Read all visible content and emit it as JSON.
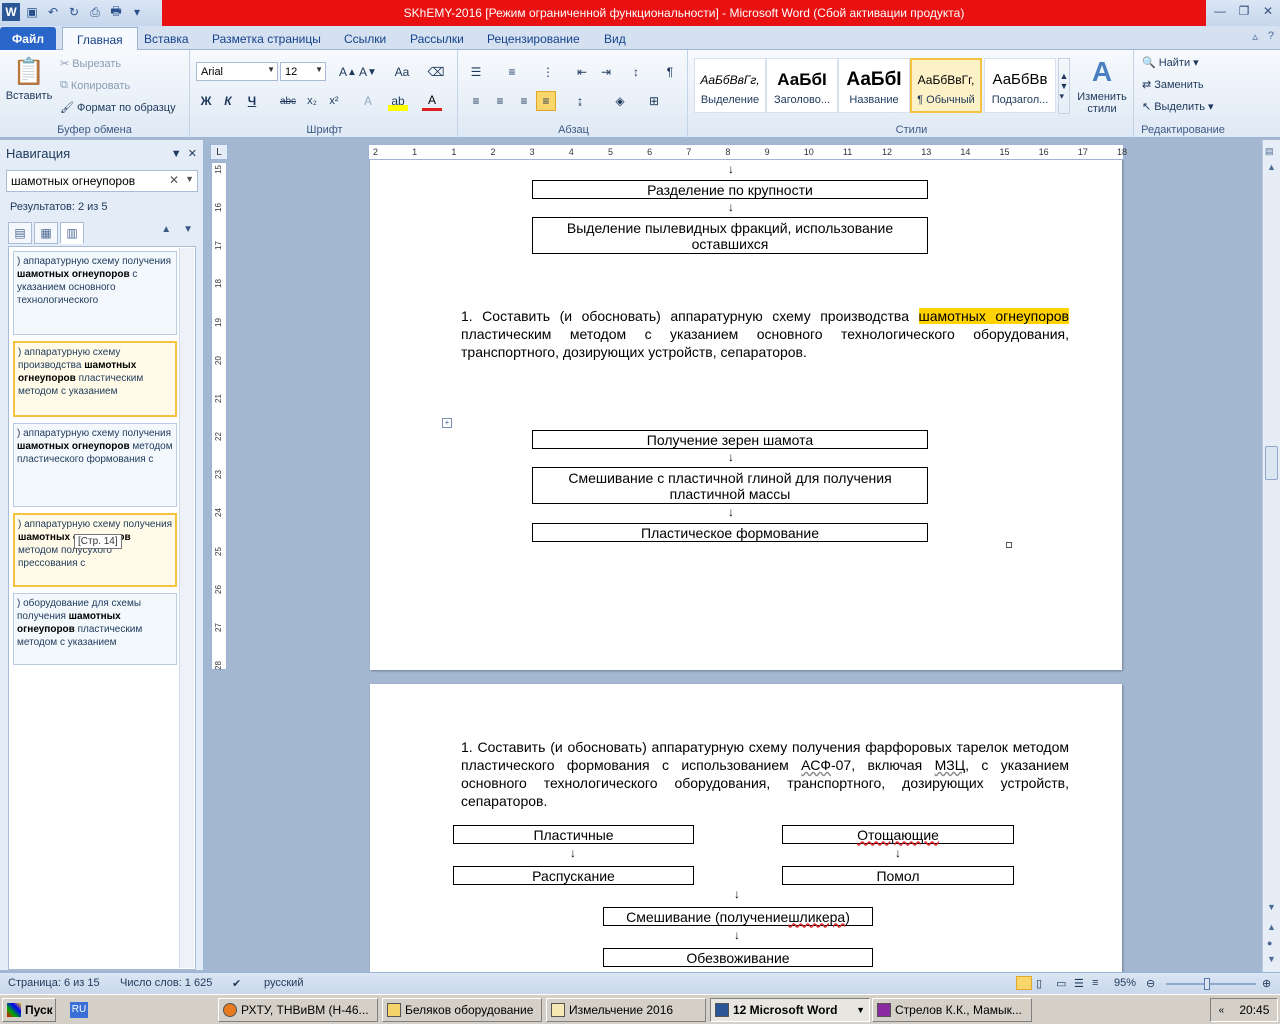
{
  "titlebar": {
    "title": "SKhEMY-2016 [Режим ограниченной функциональности]  -  Microsoft Word (Сбой активации продукта)",
    "app_icon": "W"
  },
  "tabs": [
    "Файл",
    "Главная",
    "Вставка",
    "Разметка страницы",
    "Ссылки",
    "Рассылки",
    "Рецензирование",
    "Вид"
  ],
  "ribbon": {
    "clipboard": {
      "paste": "Вставить",
      "cut": "Вырезать",
      "copy": "Копировать",
      "format_painter": "Формат по образцу",
      "label": "Буфер обмена"
    },
    "font": {
      "name": "Arial",
      "size": "12",
      "label": "Шрифт"
    },
    "paragraph": {
      "label": "Абзац"
    },
    "styles": {
      "items": [
        {
          "sample": "АаБбВвГг,",
          "name": "Выделение"
        },
        {
          "sample": "АаБбІ",
          "name": "Заголово..."
        },
        {
          "sample": "АаБбІ",
          "name": "Название"
        },
        {
          "sample": "АаБбВвГг,",
          "name": "¶ Обычный"
        },
        {
          "sample": "АаБбВв",
          "name": "Подзагол..."
        }
      ],
      "change": "Изменить стили",
      "label": "Стили"
    },
    "editing": {
      "find": "Найти",
      "replace": "Заменить",
      "select": "Выделить",
      "label": "Редактирование"
    }
  },
  "nav": {
    "title": "Навигация",
    "search_value": "шамотных огнеупоров",
    "results": "Результатов: 2 из 5",
    "tooltip": "[Стр. 14]",
    "cards": [
      {
        "pre": ") аппаратурную схему получения ",
        "bold": "шамотных огнеупоров",
        "post": " с указанием основного технологического"
      },
      {
        "pre": ") аппаратурную схему производства ",
        "bold": "шамотных огнеупоров",
        "post": " пластическим методом с указанием"
      },
      {
        "pre": ") аппаратурную схему получения ",
        "bold": "шамотных огнеупоров",
        "post": " методом пластического формования с"
      },
      {
        "pre": ") аппаратурную схему получения ",
        "bold": "шамотных огнеупоров",
        "post": " методом полусухого прессования с"
      },
      {
        "pre": ") оборудование для схемы получения ",
        "bold": "шамотных огнеупоров",
        "post": " пластическим методом с указанием"
      }
    ]
  },
  "ruler": {
    "h_ticks": [
      "2",
      "1",
      "1",
      "2",
      "3",
      "4",
      "5",
      "6",
      "7",
      "8",
      "9",
      "10",
      "11",
      "12",
      "13",
      "14",
      "15",
      "16",
      "17",
      "18"
    ],
    "v_ticks": [
      "15",
      "16",
      "17",
      "18",
      "19",
      "20",
      "21",
      "22",
      "23",
      "24",
      "25",
      "26",
      "27",
      "28"
    ]
  },
  "page1": {
    "box1": "Разделение  по крупности",
    "box2": "Выделение  пылевидных фракций, использование оставшихся",
    "para_pre": "1.  Составить  (и  обосновать)  аппаратурную  схему  производства ",
    "para_hl": "шамотных огнеупоров",
    "para_post": " пластическим  методом  с  указанием  основного  технологического оборудования, транспортного, дозирующих устройств, сепараторов.",
    "box3": "Получение  зерен  шамота",
    "box4": "Смешивание  с пластичной глиной для получения пластичной массы",
    "box5": "Пластическое формование"
  },
  "page2": {
    "para_a": "1. Составить (и обосновать) аппаратурную схему получения фарфоровых тарелок методом пластического формования с использованием ",
    "asf": "АСФ",
    "para_b": "-07, включая ",
    "mzc": "МЗЦ",
    "para_c": ", с указанием основного технологического оборудования, транспортного, дозирующих устройств, сепараторов.",
    "box_plastic": "Пластичные",
    "box_otosh": "Отощающие",
    "box_raspusk": "Распускание",
    "box_pomol": "Помол",
    "box_mix_pre": "Смешивание  (получение ",
    "box_mix_err": "шликера",
    "box_mix_post": ")",
    "box_obezv": "Обезвоживание"
  },
  "status": {
    "page": "Страница: 6 из 15",
    "words": "Число слов: 1 625",
    "lang": "русский",
    "zoom": "95%"
  },
  "taskbar": {
    "start": "Пуск",
    "lang": "RU",
    "items": [
      "РХТУ, ТНВиВМ (Н-46...",
      "Беляков оборудование",
      "Измельчение 2016",
      "12 Microsoft Word",
      "Стрелов К.К., Мамык..."
    ],
    "clock": "20:45"
  }
}
